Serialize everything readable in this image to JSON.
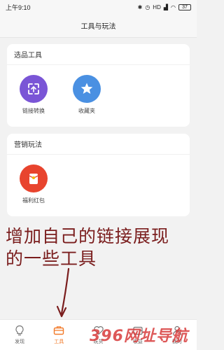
{
  "status_bar": {
    "time": "上午9:10",
    "battery": "37"
  },
  "nav": {
    "title": "工具与玩法"
  },
  "card_tools": {
    "title": "选品工具",
    "items": [
      {
        "label": "链接转换",
        "icon": "link-convert-icon",
        "color": "#7a55d6"
      },
      {
        "label": "收藏夹",
        "icon": "star-icon",
        "color": "#4a90e2"
      }
    ]
  },
  "card_marketing": {
    "title": "营销玩法",
    "items": [
      {
        "label": "福利红包",
        "icon": "red-envelope-icon",
        "color": "#e8442e"
      }
    ]
  },
  "annotation": {
    "line1": "增加自己的链接展现",
    "line2": "的一些工具"
  },
  "tabs": [
    {
      "label": "发现",
      "icon": "bulb-icon",
      "active": false
    },
    {
      "label": "工具",
      "icon": "briefcase-icon",
      "active": true
    },
    {
      "label": "玩货",
      "icon": "heart-icon",
      "active": false
    },
    {
      "label": "收益",
      "icon": "wallet-icon",
      "active": false
    },
    {
      "label": "我的",
      "icon": "user-icon",
      "active": false
    }
  ],
  "watermark": {
    "text": "396网址导航"
  }
}
